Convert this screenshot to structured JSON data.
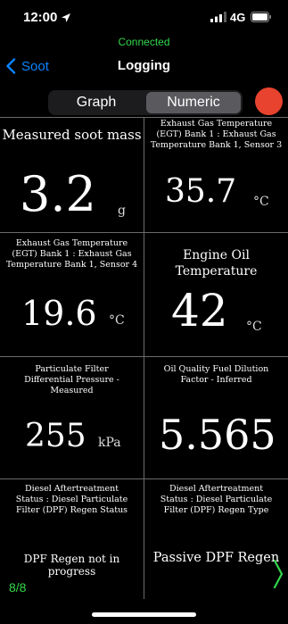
{
  "status_bar": {
    "time": "12:00",
    "network": "4G"
  },
  "connection_status": "Connected",
  "nav": {
    "back_label": "Soot",
    "title": "Logging"
  },
  "segmented": {
    "options": [
      "Graph",
      "Numeric"
    ],
    "selected": "Numeric"
  },
  "colors": {
    "connected": "#32d74b",
    "link": "#0a84ff",
    "record": "#e8432e",
    "pager": "#32d74b"
  },
  "cells": [
    {
      "label": "Measured soot mass",
      "value": "3.2",
      "unit": "g"
    },
    {
      "label": "Exhaust Gas Temperature (EGT) Bank 1 : Exhaust Gas Temperature Bank 1, Sensor 3",
      "value": "35.7",
      "unit": "°C"
    },
    {
      "label": "Exhaust Gas Temperature (EGT) Bank 1 : Exhaust Gas Temperature Bank 1, Sensor 4",
      "value": "19.6",
      "unit": "°C"
    },
    {
      "label": "Engine Oil Temperature",
      "value": "42",
      "unit": "°C"
    },
    {
      "label": "Particulate Filter Differential Pressure - Measured",
      "value": "255",
      "unit": "kPa"
    },
    {
      "label": "Oil Quality Fuel Dilution Factor - Inferred",
      "value": "5.565",
      "unit": ""
    },
    {
      "label": "Diesel Aftertreatment Status : Diesel Particulate Filter (DPF) Regen Status",
      "value": "DPF Regen not in progress",
      "unit": ""
    },
    {
      "label": "Diesel Aftertreatment Status : Diesel Particulate Filter (DPF) Regen Type",
      "value": "Passive DPF Regen",
      "unit": ""
    }
  ],
  "pager": "8/8",
  "icons": {
    "location": "location-arrow-icon",
    "signal": "signal-bars-icon",
    "battery": "battery-icon",
    "back": "chevron-left-icon",
    "next": "chevron-right-icon"
  }
}
